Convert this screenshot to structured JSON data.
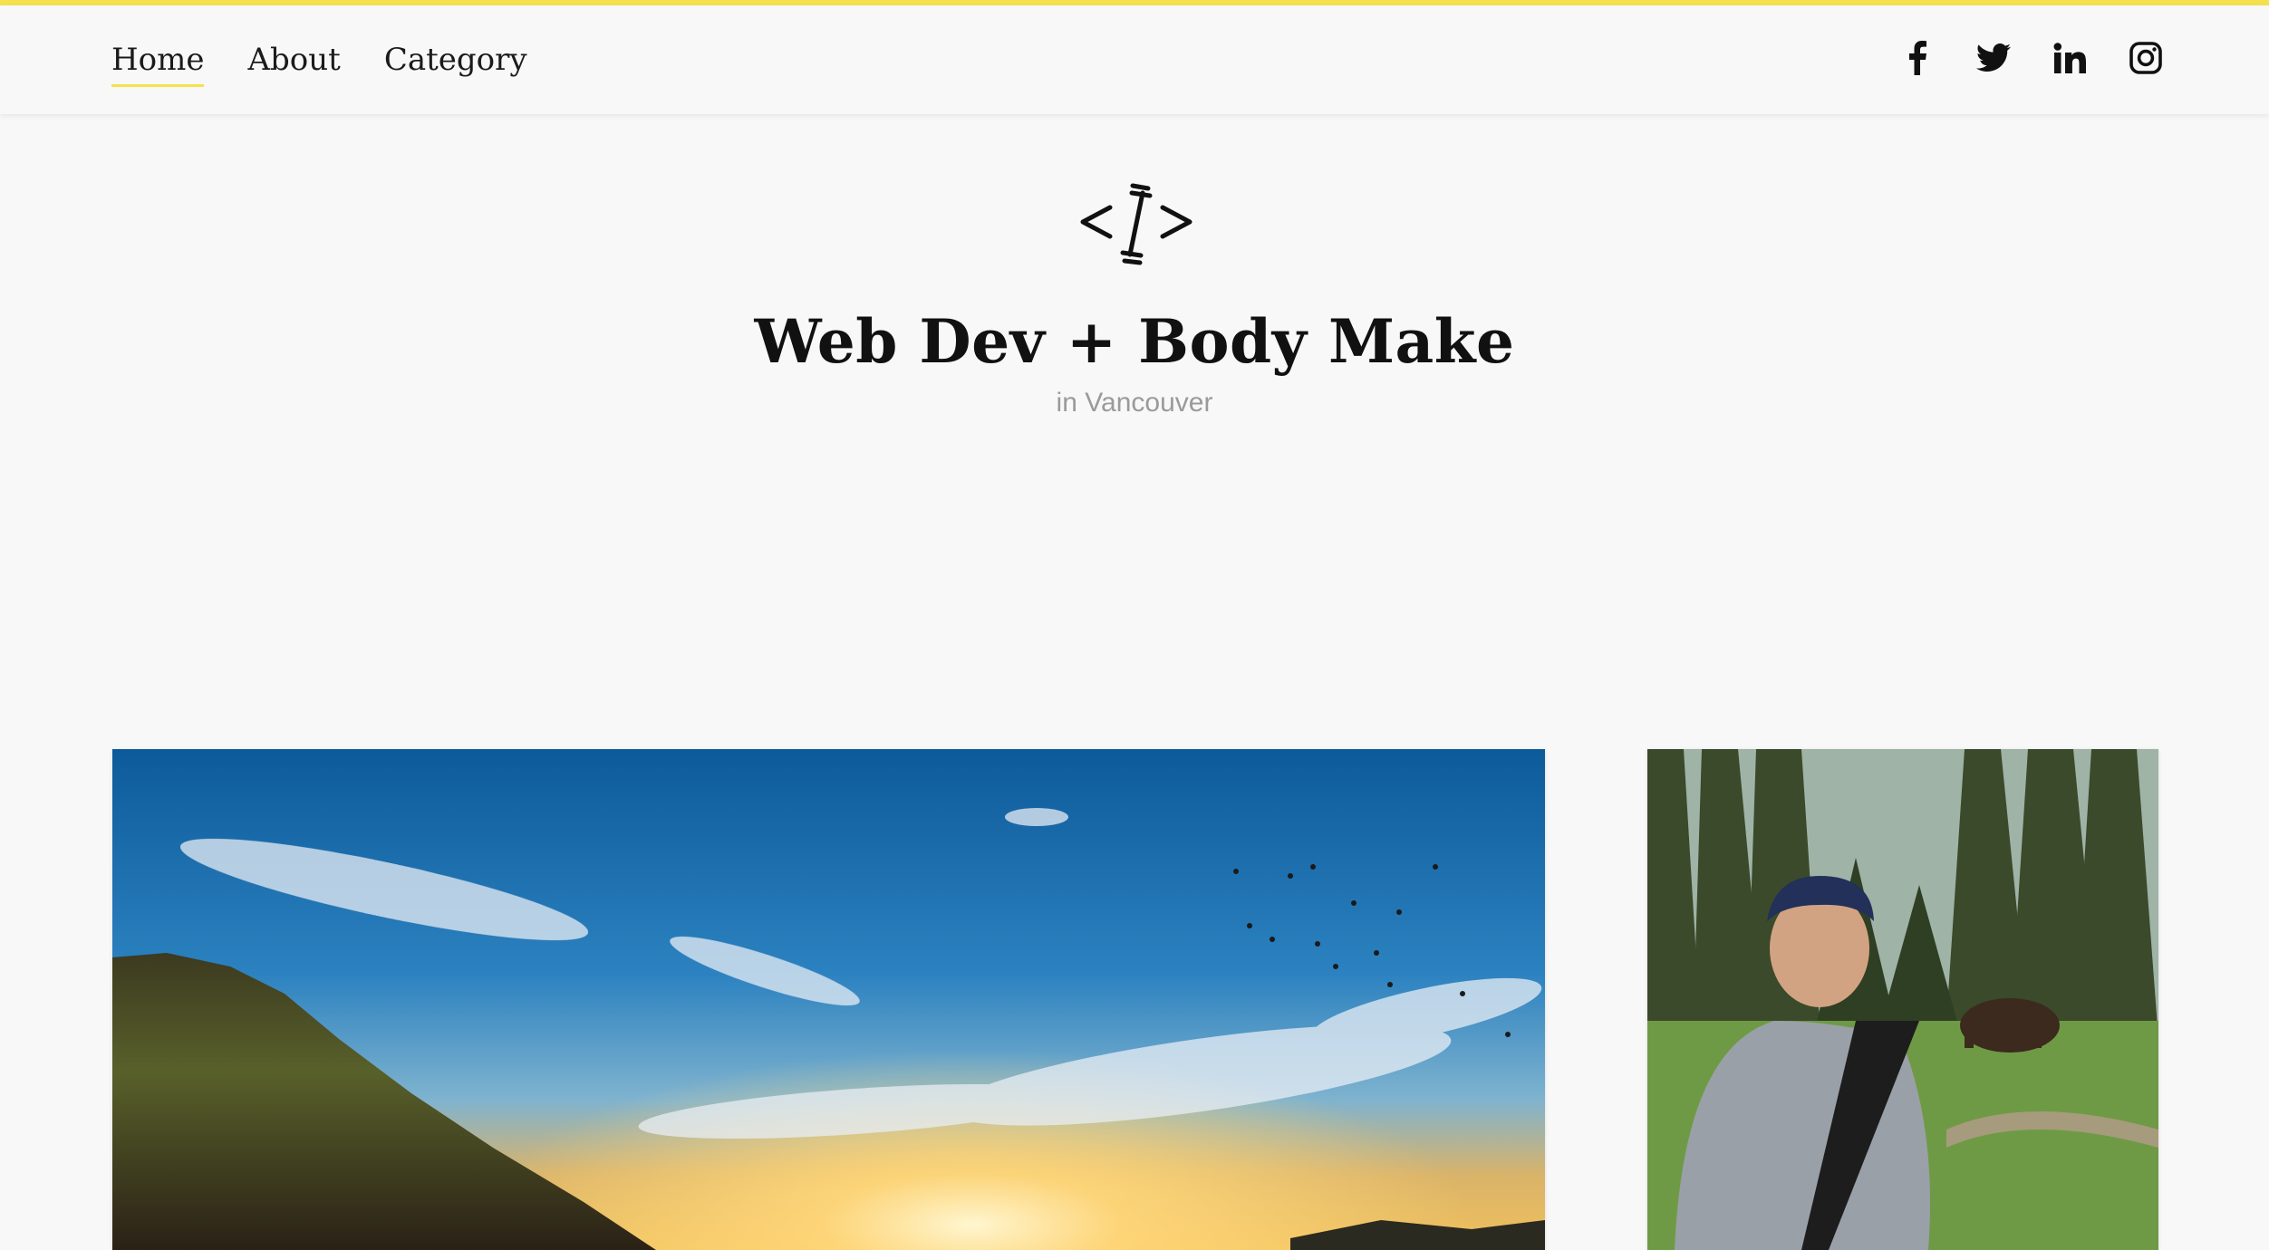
{
  "nav": {
    "items": [
      {
        "label": "Home",
        "active": true
      },
      {
        "label": "About",
        "active": false
      },
      {
        "label": "Category",
        "active": false
      }
    ],
    "social": [
      "facebook-icon",
      "twitter-icon",
      "linkedin-icon",
      "instagram-icon"
    ]
  },
  "site": {
    "title": "Web Dev + Body Make",
    "subtitle": "in Vancouver"
  },
  "colors": {
    "accent": "#f5e14e",
    "background": "#f8f8f8",
    "text": "#111111",
    "muted": "#9a9a9a"
  },
  "cards": [
    {
      "image": "sunset-landscape-photo"
    },
    {
      "image": "author-portrait-photo"
    }
  ]
}
